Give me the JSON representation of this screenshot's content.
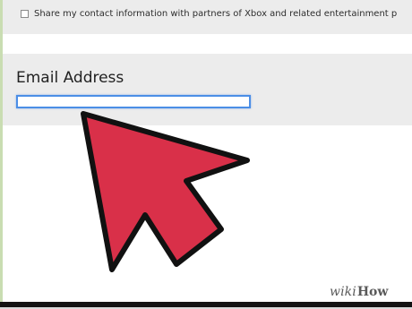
{
  "contact_sharing": {
    "checked": false,
    "label": "Share my contact information with partners of Xbox and related entertainment p"
  },
  "email": {
    "heading": "Email Address",
    "value": ""
  },
  "pointer": {
    "icon": "red-arrow-icon",
    "color": "#d93049",
    "outline_color": "#111111"
  },
  "watermark": {
    "wiki": "wiki",
    "how": "How"
  }
}
